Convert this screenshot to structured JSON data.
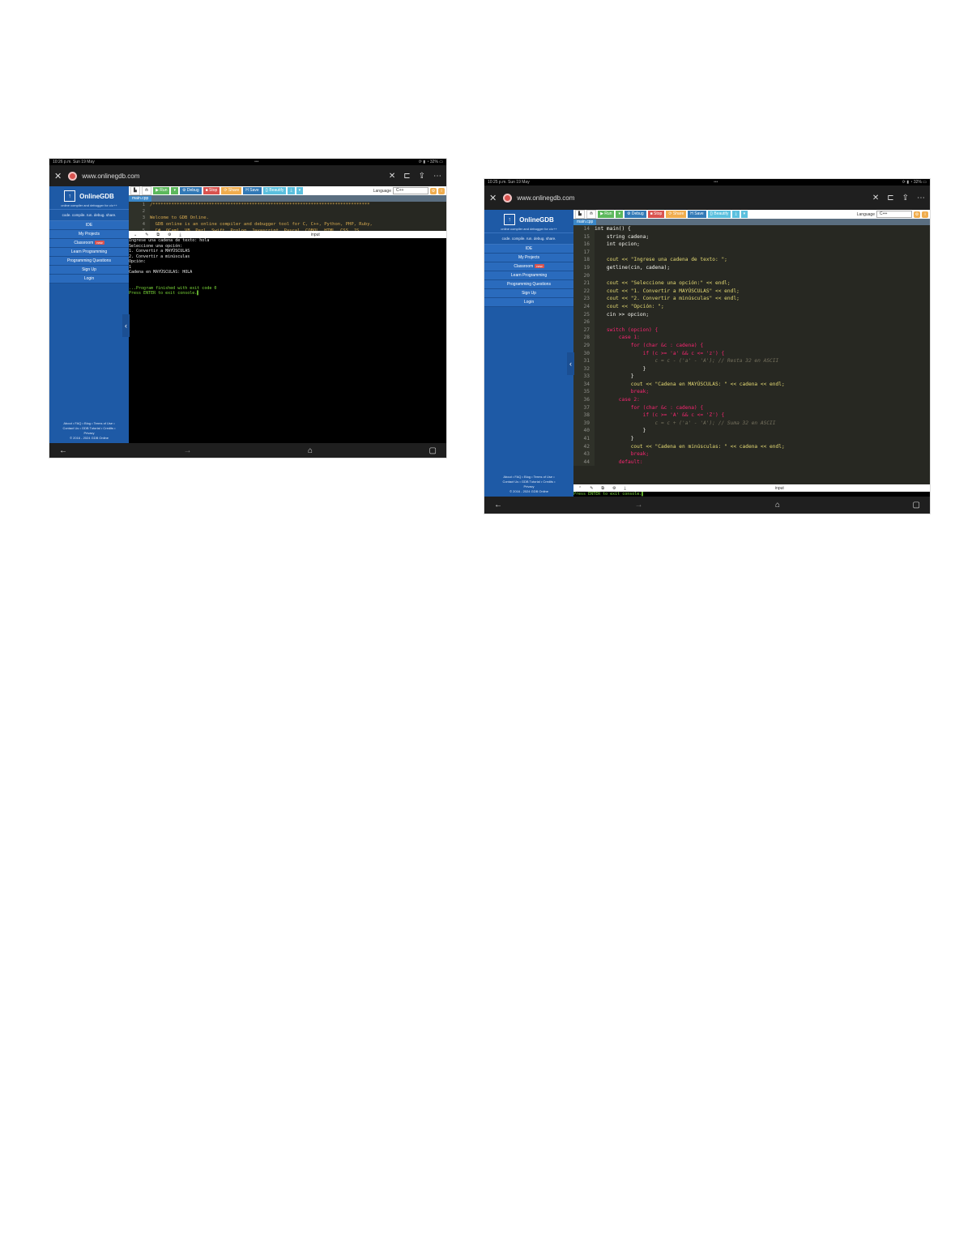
{
  "shot1": {
    "status": {
      "left": "10:26 p.m.  Sun 19 May",
      "center": "•••",
      "right": "⟳ ▮ ◔ 32% ▭"
    },
    "url": "www.onlinegdb.com",
    "sidebar": {
      "brand": "OnlineGDB",
      "brand_tag": "online compiler and debugger for c/c++",
      "tagline": "code. compile. run. debug. share.",
      "items": [
        {
          "label": "IDE"
        },
        {
          "label": "My Projects"
        },
        {
          "label": "Classroom",
          "badge": "new"
        },
        {
          "label": "Learn Programming"
        },
        {
          "label": "Programming Questions"
        },
        {
          "label": "Sign Up"
        },
        {
          "label": "Login"
        }
      ],
      "footer_1": "About • FAQ • Blog • Terms of Use •",
      "footer_2": "Contact Us • GDB Tutorial • Credits •",
      "footer_3": "Privacy",
      "footer_4": "© 2016 - 2024 GDB Online"
    },
    "toolbar": {
      "run": "▶ Run",
      "debug": "⚙ Debug",
      "stop": "■ Stop",
      "share": "⟳ Share",
      "save": "H Save",
      "beautify": "{} Beautify",
      "download": "⤓",
      "language_label": "Language",
      "language_value": "C++"
    },
    "filetab": "main.cpp",
    "editor_lines": [
      {
        "n": "1",
        "text": "/*********************************************************************************",
        "cls": "c-comment"
      },
      {
        "n": "2",
        "text": "",
        "cls": ""
      },
      {
        "n": "3",
        "text": "Welcome to GDB Online.",
        "cls": "c-comment"
      },
      {
        "n": "4",
        "text": "  GDB online is an online compiler and debugger tool for C, C++, Python, PHP, Ruby,",
        "cls": "c-comment"
      },
      {
        "n": "5",
        "text": "  C#, OCaml, VB, Perl, Swift, Prolog, Javascript, Pascal, COBOL, HTML, CSS, JS",
        "cls": "c-comment"
      }
    ],
    "io_input_label": "input",
    "console_lines": [
      {
        "text": "Ingrese una cadena de texto: hola",
        "cls": ""
      },
      {
        "text": "Seleccione una opción:",
        "cls": ""
      },
      {
        "text": "1. Convertir a MAYÚSCULAS",
        "cls": ""
      },
      {
        "text": "2. Convertir a minúsculas",
        "cls": ""
      },
      {
        "text": "Opción:",
        "cls": ""
      },
      {
        "text": "1",
        "cls": ""
      },
      {
        "text": "Cadena en MAYÚSCULAS: HOLA",
        "cls": ""
      },
      {
        "text": "",
        "cls": ""
      },
      {
        "text": "",
        "cls": ""
      },
      {
        "text": "...Program finished with exit code 0",
        "cls": "green"
      },
      {
        "text": "Press ENTER to exit console.▌",
        "cls": "green"
      }
    ]
  },
  "shot2": {
    "status": {
      "left": "10:25 p.m.  Sun 19 May",
      "center": "•••",
      "right": "⟳ ▮ ◔ 32% ▭"
    },
    "url": "www.onlinegdb.com",
    "sidebar": {
      "brand": "OnlineGDB",
      "brand_tag": "online compiler and debugger for c/c++",
      "tagline": "code. compile. run. debug. share.",
      "items": [
        {
          "label": "IDE"
        },
        {
          "label": "My Projects"
        },
        {
          "label": "Classroom",
          "badge": "new"
        },
        {
          "label": "Learn Programming"
        },
        {
          "label": "Programming Questions"
        },
        {
          "label": "Sign Up"
        },
        {
          "label": "Login"
        }
      ],
      "footer_1": "About • FAQ • Blog • Terms of Use •",
      "footer_2": "Contact Us • GDB Tutorial • Credits •",
      "footer_3": "Privacy",
      "footer_4": "© 2016 - 2024 GDB Online"
    },
    "toolbar": {
      "run": "▶ Run",
      "debug": "⚙ Debug",
      "stop": "■ Stop",
      "share": "⟳ Share",
      "save": "H Save",
      "beautify": "{} Beautify",
      "download": "⤓",
      "language_label": "Language",
      "language_value": "C++"
    },
    "filetab": "main.cpp",
    "editor_lines": [
      {
        "n": "14",
        "text": "int main() {",
        "cls": ""
      },
      {
        "n": "15",
        "text": "    string cadena;",
        "cls": ""
      },
      {
        "n": "16",
        "text": "    int opcion;",
        "cls": ""
      },
      {
        "n": "17",
        "text": "",
        "cls": ""
      },
      {
        "n": "18",
        "text": "    cout << \"Ingrese una cadena de texto: \";",
        "cls": "c-str"
      },
      {
        "n": "19",
        "text": "    getline(cin, cadena);",
        "cls": ""
      },
      {
        "n": "20",
        "text": "",
        "cls": ""
      },
      {
        "n": "21",
        "text": "    cout << \"Seleccione una opción:\" << endl;",
        "cls": "c-str"
      },
      {
        "n": "22",
        "text": "    cout << \"1. Convertir a MAYÚSCULAS\" << endl;",
        "cls": "c-str"
      },
      {
        "n": "23",
        "text": "    cout << \"2. Convertir a minúsculas\" << endl;",
        "cls": "c-str"
      },
      {
        "n": "24",
        "text": "    cout << \"Opción: \";",
        "cls": "c-str"
      },
      {
        "n": "25",
        "text": "    cin >> opcion;",
        "cls": ""
      },
      {
        "n": "26",
        "text": "",
        "cls": ""
      },
      {
        "n": "27",
        "text": "    switch (opcion) {",
        "cls": "c-kw"
      },
      {
        "n": "28",
        "text": "        case 1:",
        "cls": "c-kw"
      },
      {
        "n": "29",
        "text": "            for (char &c : cadena) {",
        "cls": "c-kw"
      },
      {
        "n": "30",
        "text": "                if (c >= 'a' && c <= 'z') {",
        "cls": "c-kw"
      },
      {
        "n": "31",
        "text": "                    c = c - ('a' - 'A'); // Resta 32 en ASCII",
        "cls": "c-cm2"
      },
      {
        "n": "32",
        "text": "                }",
        "cls": ""
      },
      {
        "n": "33",
        "text": "            }",
        "cls": ""
      },
      {
        "n": "34",
        "text": "            cout << \"Cadena en MAYÚSCULAS: \" << cadena << endl;",
        "cls": "c-str"
      },
      {
        "n": "35",
        "text": "            break;",
        "cls": "c-kw"
      },
      {
        "n": "36",
        "text": "        case 2:",
        "cls": "c-kw"
      },
      {
        "n": "37",
        "text": "            for (char &c : cadena) {",
        "cls": "c-kw"
      },
      {
        "n": "38",
        "text": "                if (c >= 'A' && c <= 'Z') {",
        "cls": "c-kw"
      },
      {
        "n": "39",
        "text": "                    c = c + ('a' - 'A'); // Suma 32 en ASCII",
        "cls": "c-cm2"
      },
      {
        "n": "40",
        "text": "                }",
        "cls": ""
      },
      {
        "n": "41",
        "text": "            }",
        "cls": ""
      },
      {
        "n": "42",
        "text": "            cout << \"Cadena en minúsculas: \" << cadena << endl;",
        "cls": "c-str"
      },
      {
        "n": "43",
        "text": "            break;",
        "cls": "c-kw"
      },
      {
        "n": "44",
        "text": "        default:",
        "cls": "c-kw"
      }
    ],
    "io_input_label": "input",
    "console_lines": [
      {
        "text": "Press ENTER to exit console.▌",
        "cls": "green"
      }
    ]
  }
}
